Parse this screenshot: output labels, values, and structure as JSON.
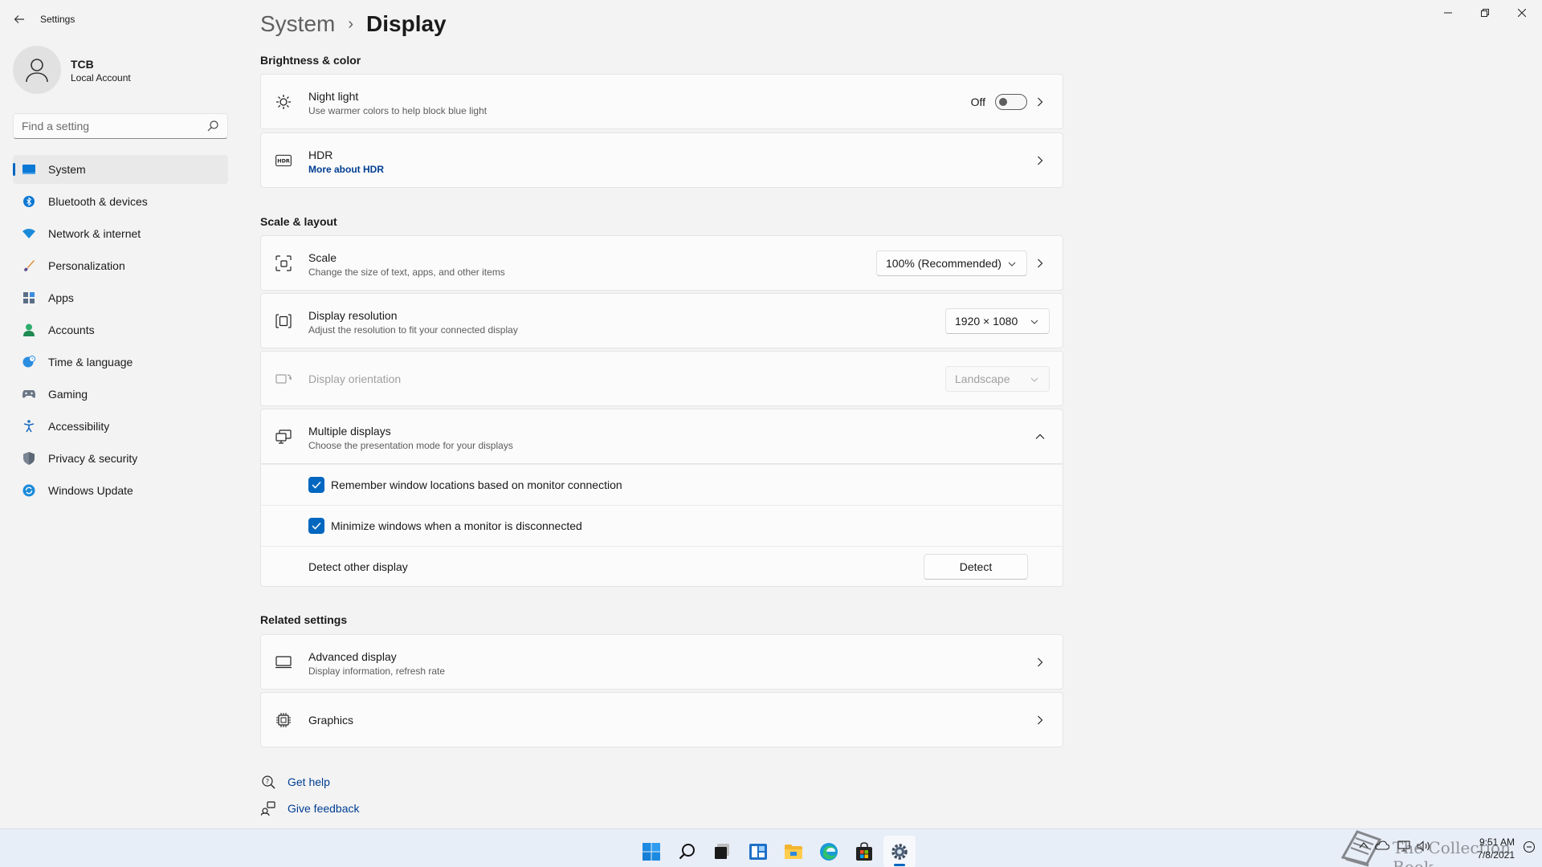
{
  "app": {
    "title": "Settings"
  },
  "window_controls": {
    "minimize": "—",
    "maximize": "❐",
    "close": "✕"
  },
  "user": {
    "name": "TCB",
    "account_type": "Local Account"
  },
  "search": {
    "placeholder": "Find a setting"
  },
  "sidebar": {
    "items": [
      {
        "label": "System",
        "icon": "system-icon",
        "active": true
      },
      {
        "label": "Bluetooth & devices",
        "icon": "bluetooth-icon"
      },
      {
        "label": "Network & internet",
        "icon": "wifi-icon"
      },
      {
        "label": "Personalization",
        "icon": "brush-icon"
      },
      {
        "label": "Apps",
        "icon": "apps-icon"
      },
      {
        "label": "Accounts",
        "icon": "person-icon"
      },
      {
        "label": "Time & language",
        "icon": "globe-clock-icon"
      },
      {
        "label": "Gaming",
        "icon": "gamepad-icon"
      },
      {
        "label": "Accessibility",
        "icon": "accessibility-icon"
      },
      {
        "label": "Privacy & security",
        "icon": "shield-icon"
      },
      {
        "label": "Windows Update",
        "icon": "update-icon"
      }
    ]
  },
  "breadcrumb": {
    "parent": "System",
    "separator": "›",
    "current": "Display"
  },
  "brightness": {
    "section_title": "Brightness & color",
    "night_light": {
      "title": "Night light",
      "subtitle": "Use warmer colors to help block blue light",
      "state_label": "Off",
      "enabled": false
    },
    "hdr": {
      "title": "HDR",
      "link": "More about HDR"
    }
  },
  "scale_layout": {
    "section_title": "Scale & layout",
    "scale": {
      "title": "Scale",
      "subtitle": "Change the size of text, apps, and other items",
      "value": "100% (Recommended)"
    },
    "resolution": {
      "title": "Display resolution",
      "subtitle": "Adjust the resolution to fit your connected display",
      "value": "1920 × 1080"
    },
    "orientation": {
      "title": "Display orientation",
      "value": "Landscape",
      "disabled": true
    },
    "multiple_displays": {
      "title": "Multiple displays",
      "subtitle": "Choose the presentation mode for your displays",
      "expanded": true,
      "remember_windows": {
        "label": "Remember window locations based on monitor connection",
        "checked": true
      },
      "minimize_windows": {
        "label": "Minimize windows when a monitor is disconnected",
        "checked": true
      },
      "detect": {
        "label": "Detect other display",
        "button": "Detect"
      }
    }
  },
  "related": {
    "section_title": "Related settings",
    "advanced_display": {
      "title": "Advanced display",
      "subtitle": "Display information, refresh rate"
    },
    "graphics": {
      "title": "Graphics"
    }
  },
  "help": {
    "get_help": "Get help",
    "give_feedback": "Give feedback"
  },
  "taskbar": {
    "apps": [
      "start-icon",
      "search-icon",
      "task-view-icon",
      "widgets-icon",
      "file-explorer-icon",
      "edge-icon",
      "store-icon",
      "settings-icon"
    ],
    "clock": {
      "time": "9:51 AM",
      "date": "7/8/2021"
    },
    "watermark": "The Collection Book"
  },
  "colors": {
    "accent": "#0067c0",
    "link": "#003e92",
    "background": "#f3f3f3",
    "card": "#fbfbfb"
  }
}
